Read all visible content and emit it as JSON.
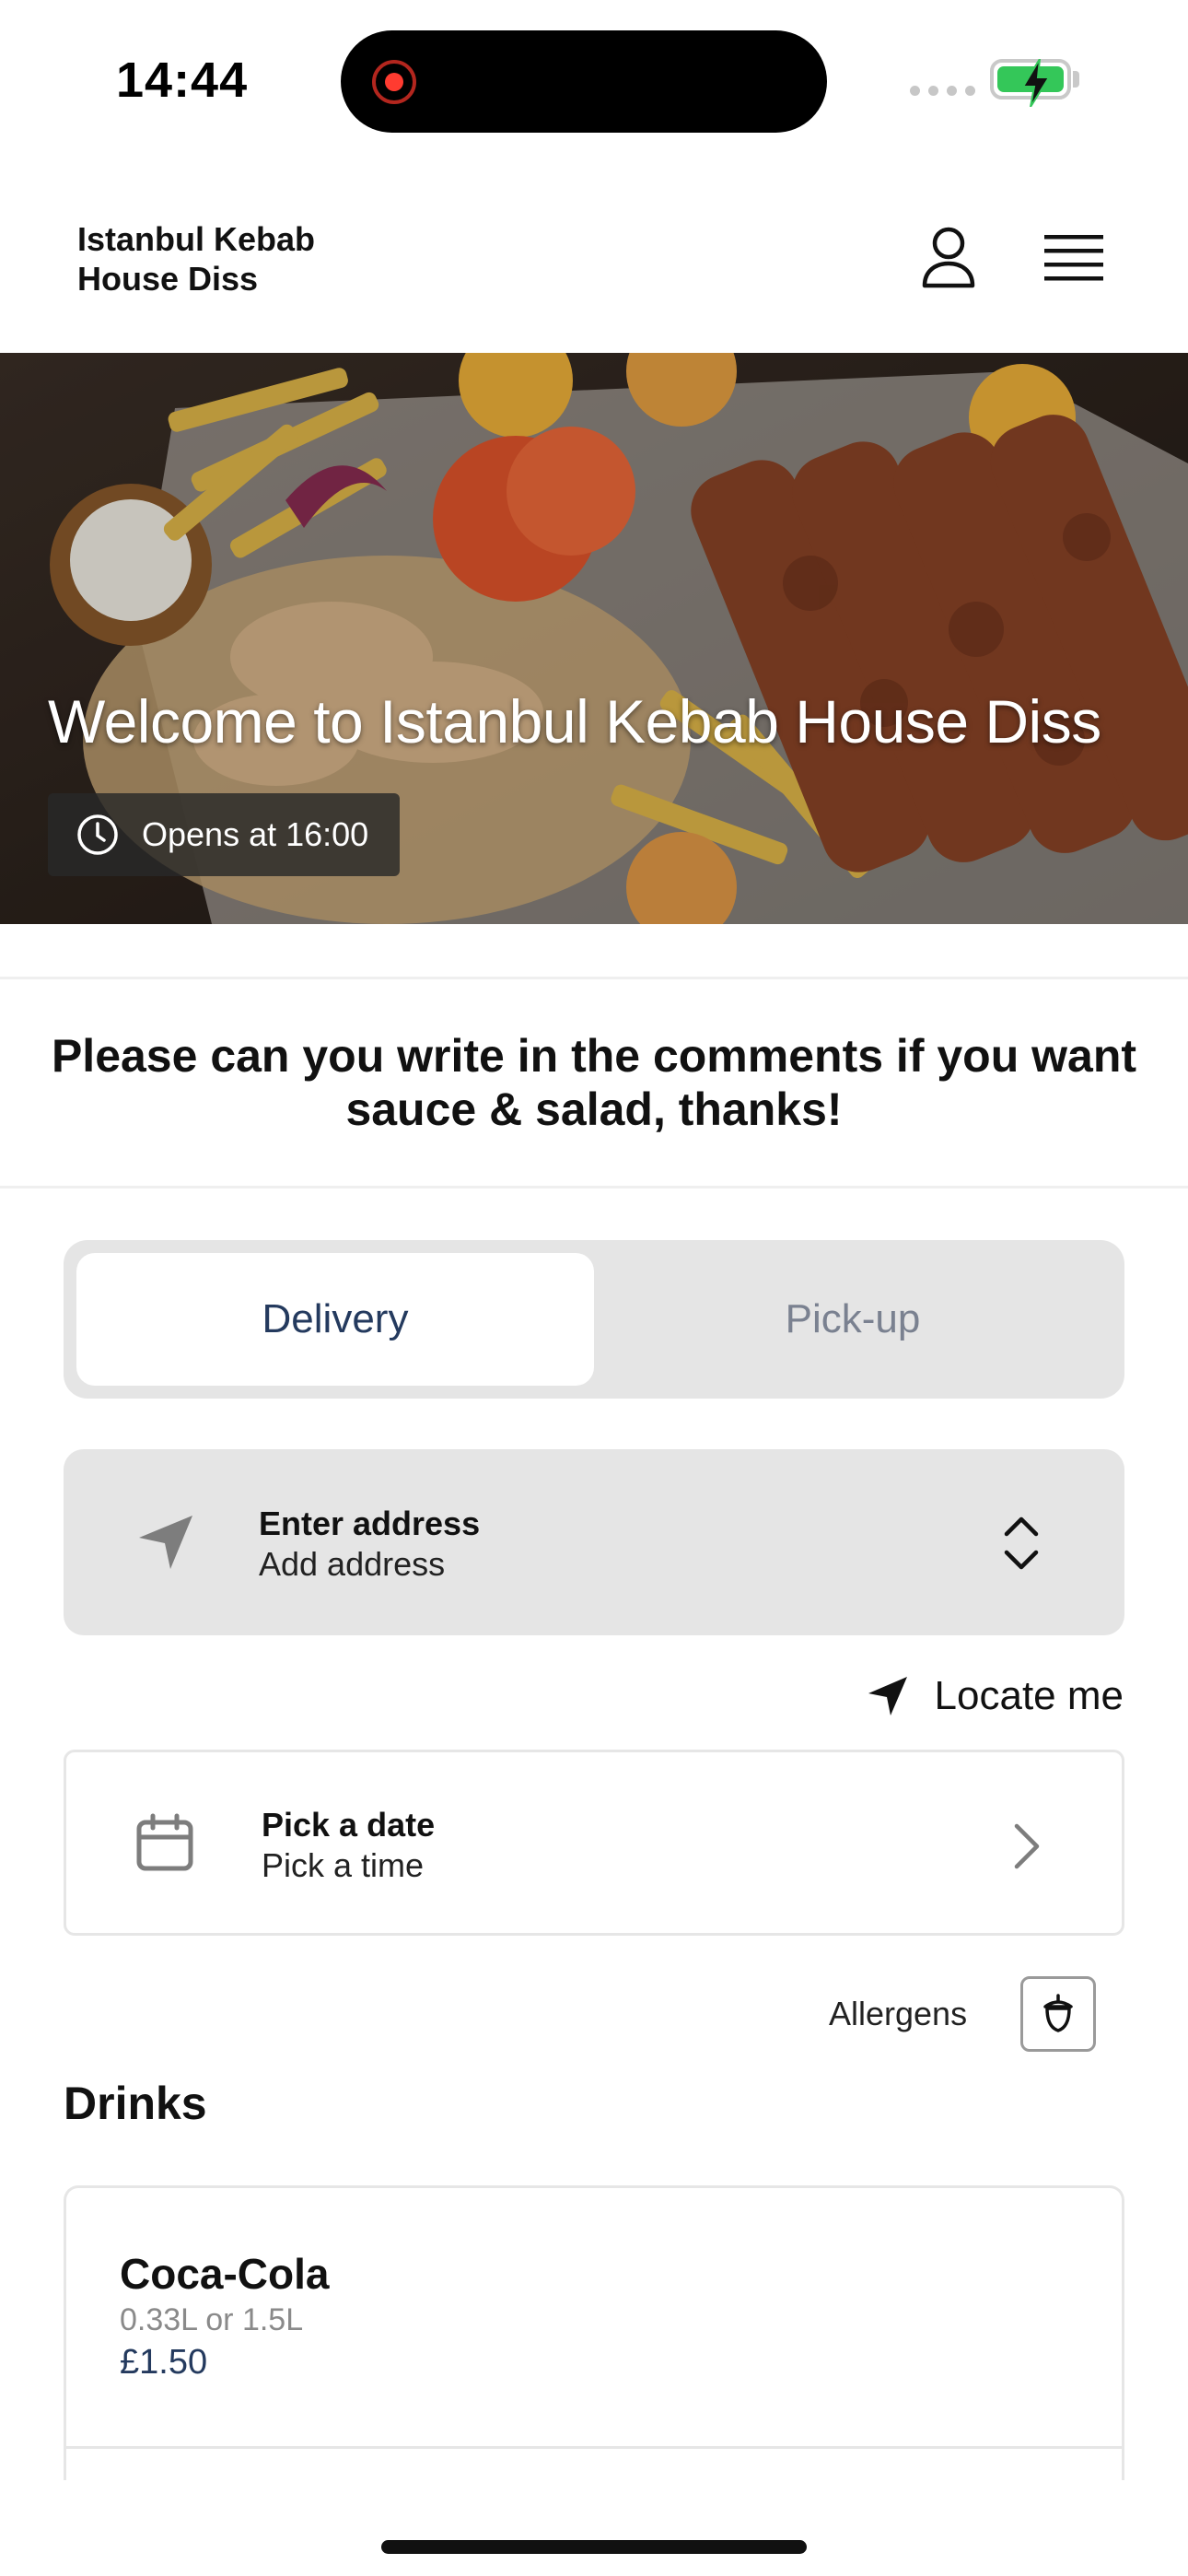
{
  "status_bar": {
    "time": "14:44"
  },
  "header": {
    "brand": "Istanbul Kebab House Diss",
    "icons": [
      "user-icon",
      "hamburger-menu-icon"
    ]
  },
  "hero": {
    "title": "Welcome to Istanbul Kebab House Diss",
    "opens_text": "Opens at 16:00"
  },
  "notice": {
    "text": "Please can you write in the comments if you want sauce & salad, thanks!"
  },
  "order_mode": {
    "options": [
      "Delivery",
      "Pick-up"
    ],
    "selected": "Delivery"
  },
  "address": {
    "title": "Enter address",
    "subtitle": "Add address"
  },
  "locate": {
    "label": "Locate me"
  },
  "schedule": {
    "title": "Pick a date",
    "subtitle": "Pick a time"
  },
  "allergens": {
    "label": "Allergens"
  },
  "menu": {
    "section_title": "Drinks",
    "items": [
      {
        "name": "Coca-Cola",
        "description": "0.33L or 1.5L",
        "price": "£1.50"
      }
    ]
  },
  "colors": {
    "accent_text": "#243a5e",
    "segment_bg": "#e5e5e5",
    "battery_green": "#34c759"
  }
}
